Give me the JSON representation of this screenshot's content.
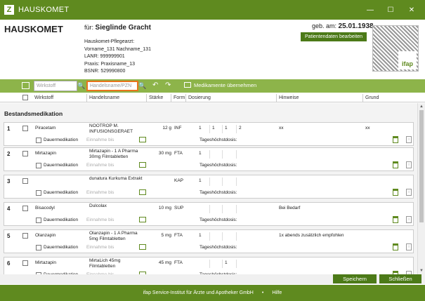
{
  "window": {
    "title": "HAUSKOMET",
    "logo_glyph": "Z",
    "min": "—",
    "max": "☐",
    "close": "✕"
  },
  "header": {
    "brand": "HAUSKOMET",
    "fuer_label": "für:",
    "patient_name": "Sieglinde Gracht",
    "arzt_lines": [
      "Hauskomet-Pflegearzt:",
      "Vorname_131 Nachname_131",
      "LANR: 999999901",
      "Praxis: Praxisname_13",
      "BSNR: 529990800"
    ],
    "geb_label": "geb. am:",
    "geb_date": "25.01.1938",
    "edit_button": "Patientendaten bearbeiten",
    "qr_brand": "ifap"
  },
  "toolbar": {
    "wirkstoff_placeholder": "Wirkstoff",
    "handelsname_placeholder": "Handelsname/PZN",
    "uebernehmen_label": "Medikamente übernehmen",
    "search_glyph": "🔍",
    "undo_glyph": "↶",
    "redo_glyph": "↷"
  },
  "columns": [
    "Wirkstoff",
    "Handelsname",
    "Stärke",
    "Form",
    "Dosierung",
    "Hinweise",
    "Grund"
  ],
  "section_title": "Bestandsmedikation",
  "row_labels": {
    "dauermedikation": "Dauermedikation",
    "einnahme_bis": "Einnahme bis",
    "tageshoechstdosis": "Tageshöchstdosis:"
  },
  "rows": [
    {
      "num": "1",
      "wirkstoff": "Piracetam",
      "handelsname": "NOOTROP M. INFUSIONSGERAET",
      "staerke": "12 g",
      "form": "INF",
      "d1": "1",
      "d2": "1",
      "d3": "1",
      "d4": "2",
      "hinweise": "xx",
      "grund": "xx"
    },
    {
      "num": "2",
      "wirkstoff": "Mirtazapin",
      "handelsname": "Mirtazapin - 1 A Pharma 30mg Filmtabletten",
      "staerke": "30 mg",
      "form": "FTA",
      "d1": "1",
      "d2": "",
      "d3": "",
      "d4": "",
      "hinweise": "",
      "grund": ""
    },
    {
      "num": "3",
      "wirkstoff": "",
      "handelsname": "dunatura Kurkuma Extrakt",
      "staerke": "",
      "form": "KAP",
      "d1": "1",
      "d2": "",
      "d3": "",
      "d4": "",
      "hinweise": "",
      "grund": ""
    },
    {
      "num": "4",
      "wirkstoff": "Bisacodyl",
      "handelsname": "Dulcolax",
      "staerke": "10 mg",
      "form": "SUP",
      "d1": "",
      "d2": "",
      "d3": "",
      "d4": "",
      "hinweise": "Bei Bedarf",
      "grund": ""
    },
    {
      "num": "5",
      "wirkstoff": "Olanzapin",
      "handelsname": "Olanzapin - 1 A Pharma 5mg Filmtabletten",
      "staerke": "5 mg",
      "form": "FTA",
      "d1": "1",
      "d2": "",
      "d3": "",
      "d4": "",
      "hinweise": "1x abends zusätzlich empfohlen",
      "grund": ""
    },
    {
      "num": "6",
      "wirkstoff": "Mirtazapin",
      "handelsname": "MirtaLich 45mg Filmtabletten",
      "staerke": "45 mg",
      "form": "FTA",
      "d1": "",
      "d2": "",
      "d3": "1",
      "d4": "",
      "hinweise": "",
      "grund": ""
    }
  ],
  "buttons": {
    "speichern": "Speichern",
    "schliessen": "Schließen"
  },
  "footer": {
    "institute": "ifap Service-Institut für Ärzte und Apotheker GmbH",
    "bullet": "•",
    "hilfe": "Hilfe"
  }
}
